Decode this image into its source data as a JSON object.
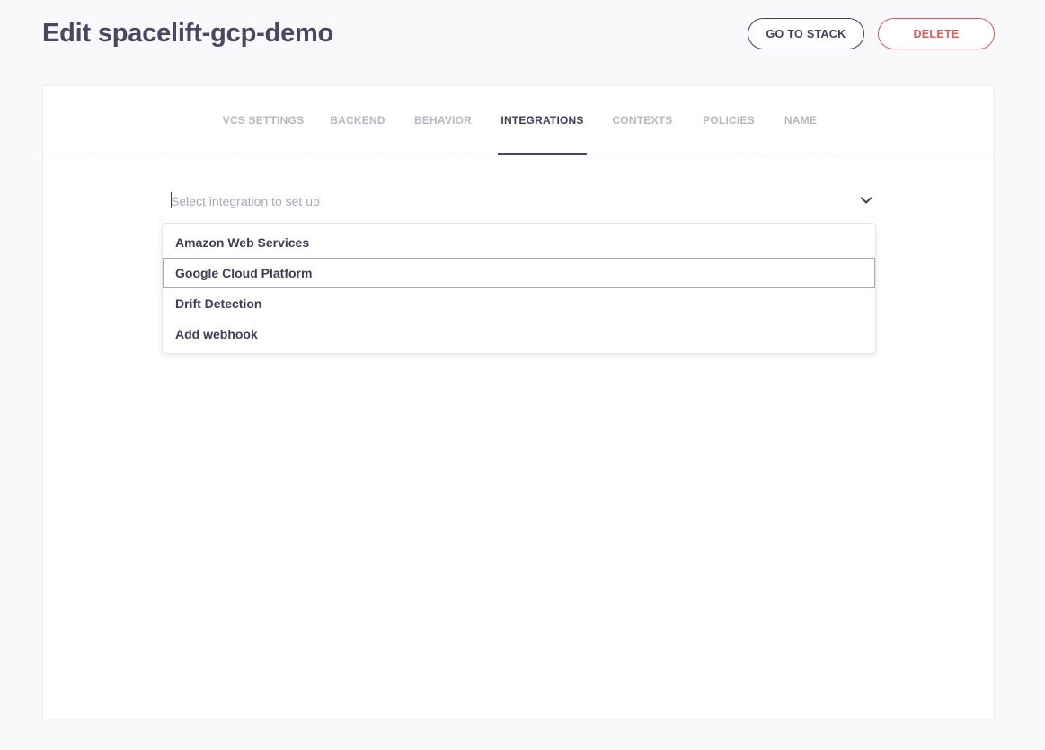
{
  "header": {
    "title": "Edit spacelift-gcp-demo",
    "go_to_stack_label": "GO TO STACK",
    "delete_label": "DELETE"
  },
  "tabs": [
    {
      "label": "VCS SETTINGS",
      "active": false
    },
    {
      "label": "BACKEND",
      "active": false
    },
    {
      "label": "BEHAVIOR",
      "active": false
    },
    {
      "label": "INTEGRATIONS",
      "active": true
    },
    {
      "label": "CONTEXTS",
      "active": false
    },
    {
      "label": "POLICIES",
      "active": false
    },
    {
      "label": "NAME",
      "active": false
    }
  ],
  "integration_select": {
    "placeholder": "Select integration to set up",
    "value": "",
    "icon": "chevron-down-icon"
  },
  "dropdown": {
    "options": [
      {
        "label": "Amazon Web Services"
      },
      {
        "label": "Google Cloud Platform",
        "hovered": true
      },
      {
        "label": "Drift Detection"
      },
      {
        "label": "Add webhook"
      }
    ]
  },
  "colors": {
    "primary": "#3f3d56",
    "danger": "#e05a5a",
    "tab_inactive": "#b8b6c6",
    "background": "#f9f9fc"
  }
}
